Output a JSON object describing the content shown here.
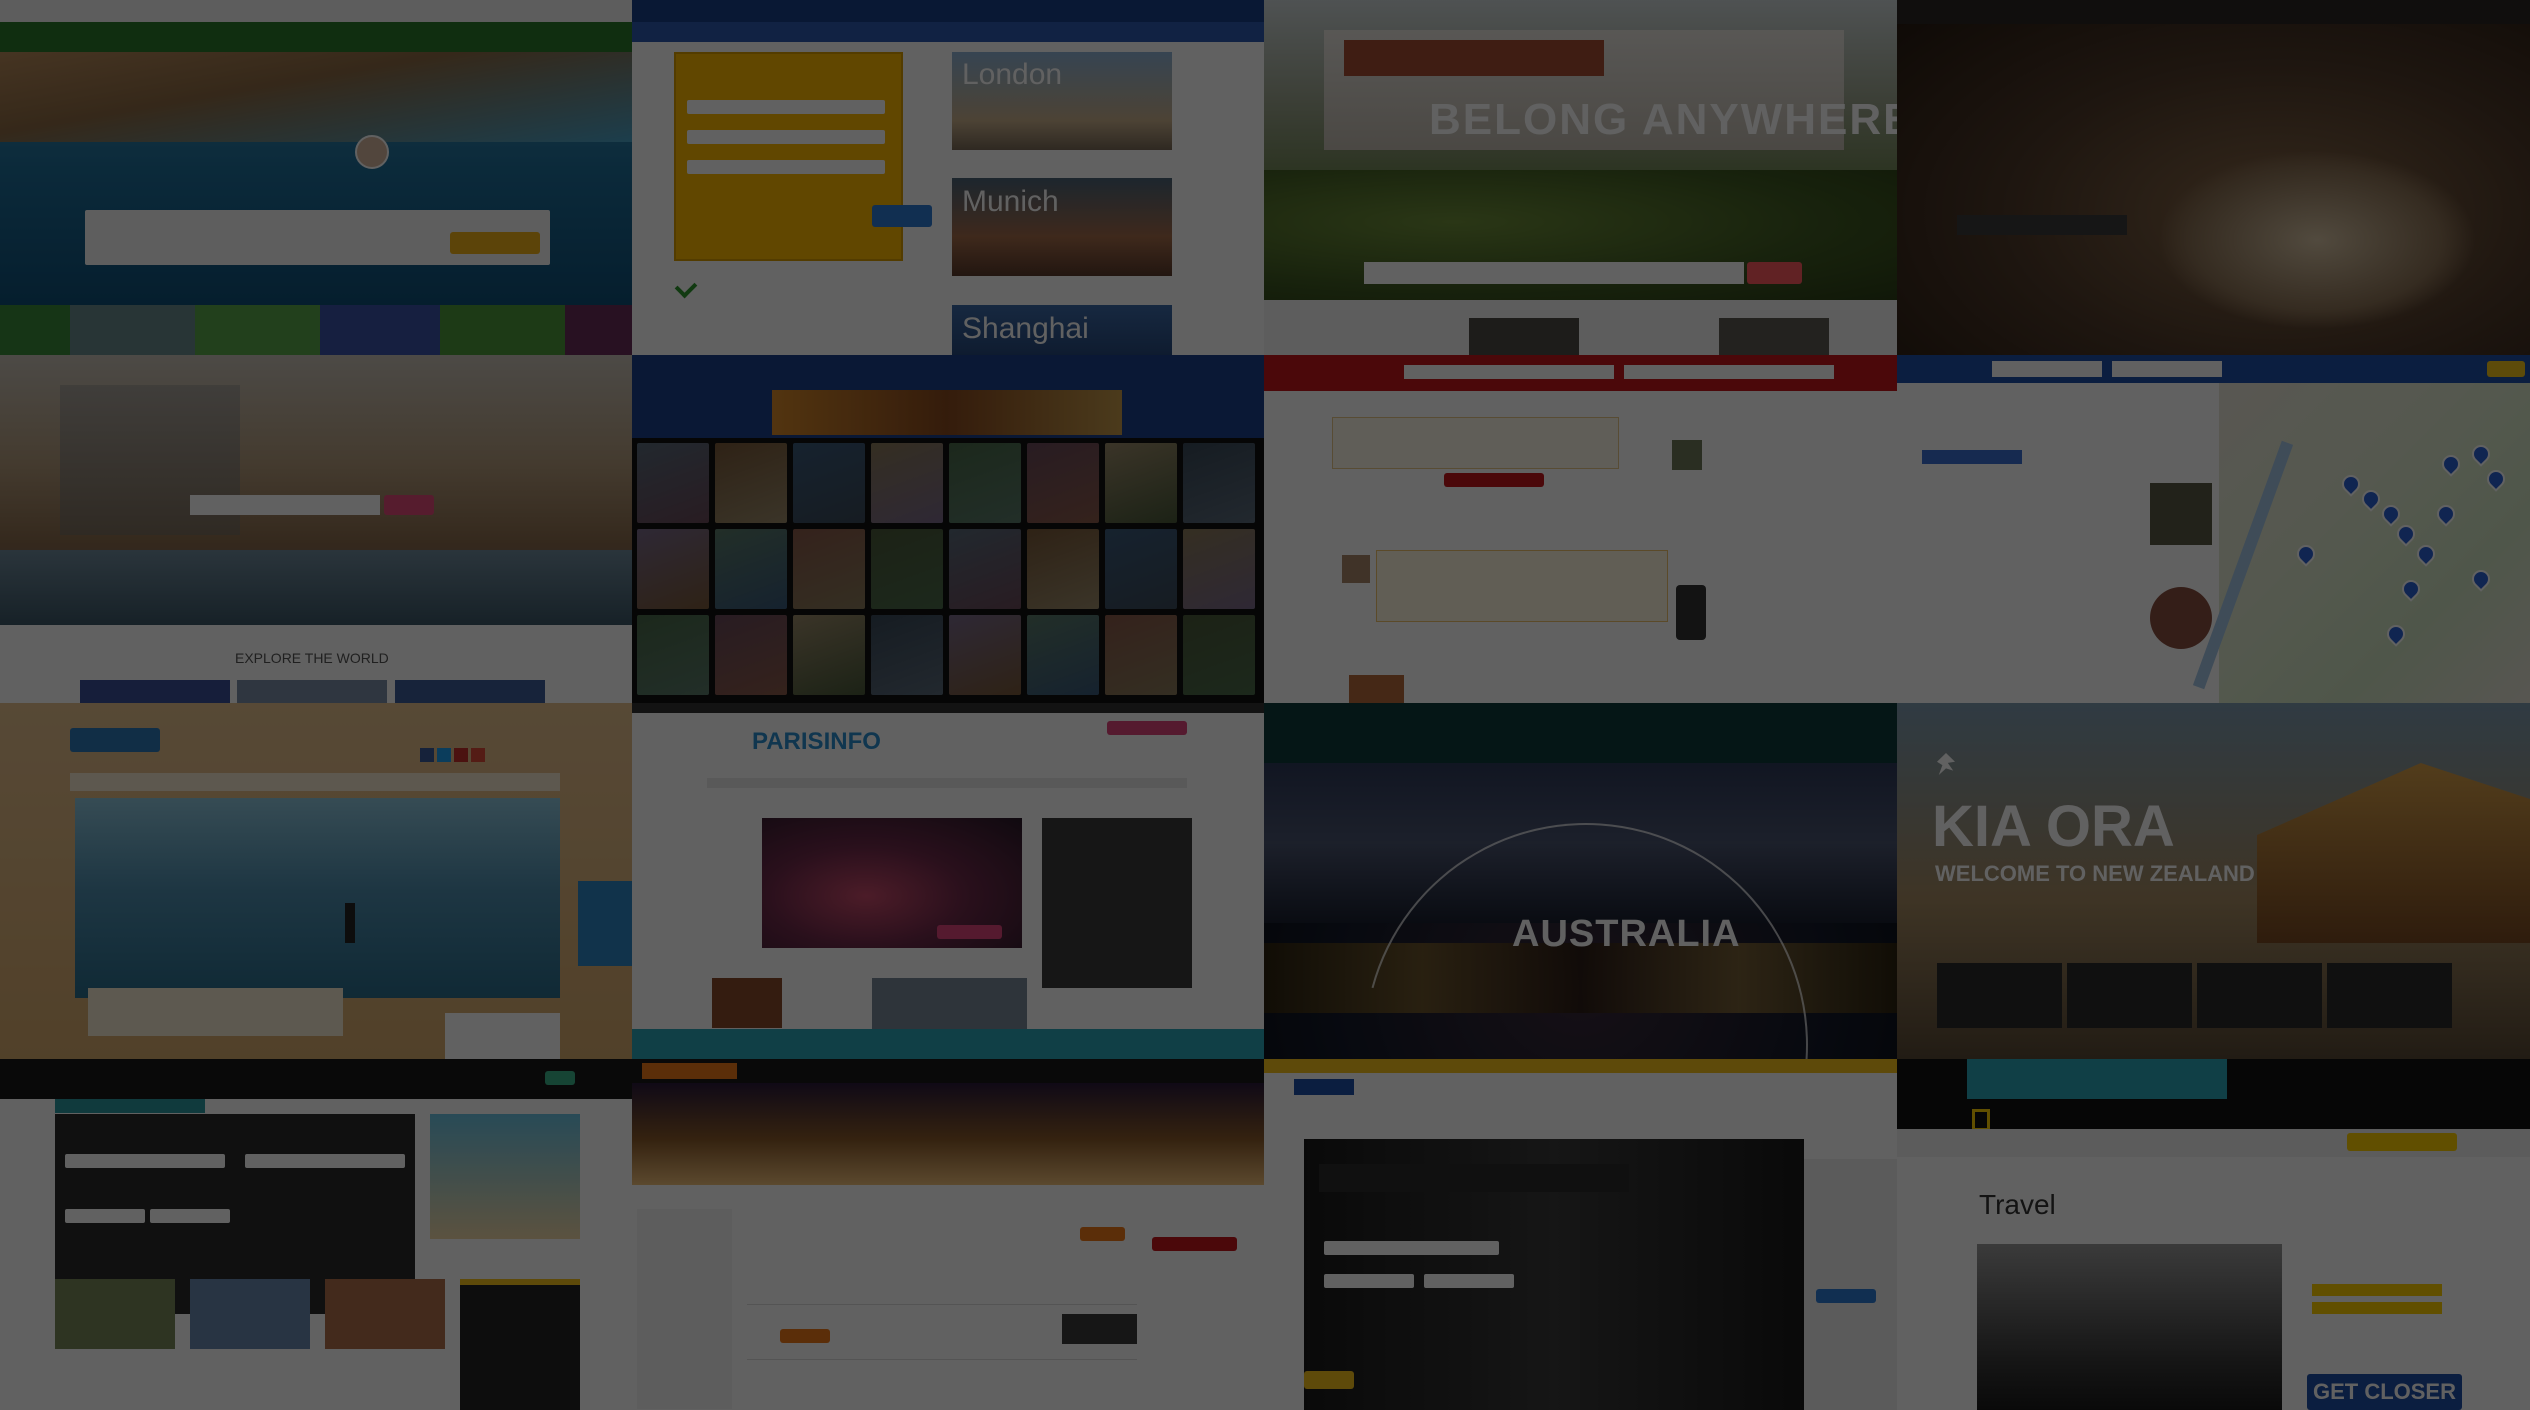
{
  "belong": {
    "headline": "BELONG ANYWHERE"
  },
  "london": {
    "label": "London"
  },
  "munich": {
    "label": "Munich"
  },
  "shanghai": {
    "label": "Shanghai"
  },
  "explore": {
    "label": "EXPLORE THE WORLD"
  },
  "parisinfo": {
    "logo": "PARISINFO"
  },
  "australia": {
    "headline": "AUSTRALIA"
  },
  "nz": {
    "headline": "KIA ORA",
    "subheadline": "WELCOME TO NEW ZEALAND"
  },
  "natgeo": {
    "section": "Travel",
    "cta": "GET CLOSER"
  },
  "colors": {
    "overlay": "rgba(0,0,0,0.62)",
    "booking_blue": "#1a3f8a",
    "yelp_red": "#c4161c",
    "paris_teal": "#2aa6b8",
    "natgeo_yellow": "#ffcf00",
    "expedia_yellow": "#f7c21b",
    "airbnb_pink": "#ff5a5f"
  }
}
